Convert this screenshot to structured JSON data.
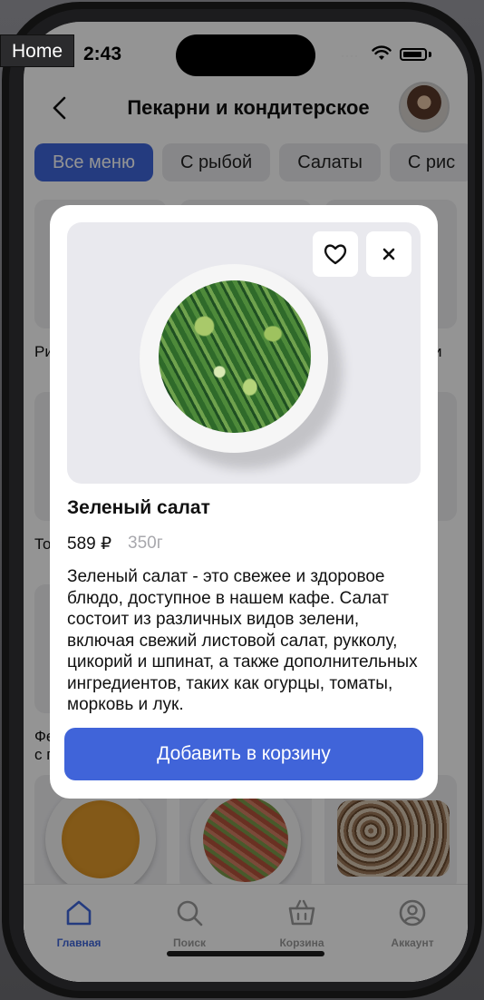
{
  "overlay_label": "Home",
  "status_bar": {
    "time": "2:43",
    "signal_dots": "····"
  },
  "header": {
    "title": "Пекарни и кондитерское"
  },
  "tabs": [
    {
      "label": "Все меню",
      "active": true
    },
    {
      "label": "С рыбой",
      "active": false
    },
    {
      "label": "Салаты",
      "active": false
    },
    {
      "label": "С рис",
      "active": false
    }
  ],
  "background_labels": {
    "row1_left": "Ри",
    "row1_right": "и",
    "row2_left": "То",
    "row3_left_line1": "Фе",
    "row3_left_line2": "с п"
  },
  "modal": {
    "dish_name": "Зеленый салат",
    "price": "589 ₽",
    "weight": "350г",
    "description": "Зеленый салат - это свежее и здоровое блюдо, доступное в нашем кафе. Салат состоит из различных видов зелени, включая свежий листовой салат, рукколу, цикорий и шпинат, а также дополнительных ингредиентов, таких как огурцы, томаты, морковь и лук.",
    "add_to_cart_label": "Добавить в корзину",
    "favorite_icon": "heart-icon",
    "close_icon": "close-icon"
  },
  "tab_bar": [
    {
      "label": "Главная",
      "icon": "home-icon",
      "active": true
    },
    {
      "label": "Поиск",
      "icon": "search-icon",
      "active": false
    },
    {
      "label": "Корзина",
      "icon": "basket-icon",
      "active": false
    },
    {
      "label": "Аккаунт",
      "icon": "account-icon",
      "active": false
    }
  ],
  "colors": {
    "accent": "#4064d9",
    "overlay": "rgba(0,0,0,0.42)",
    "muted": "#a8a8ad"
  }
}
